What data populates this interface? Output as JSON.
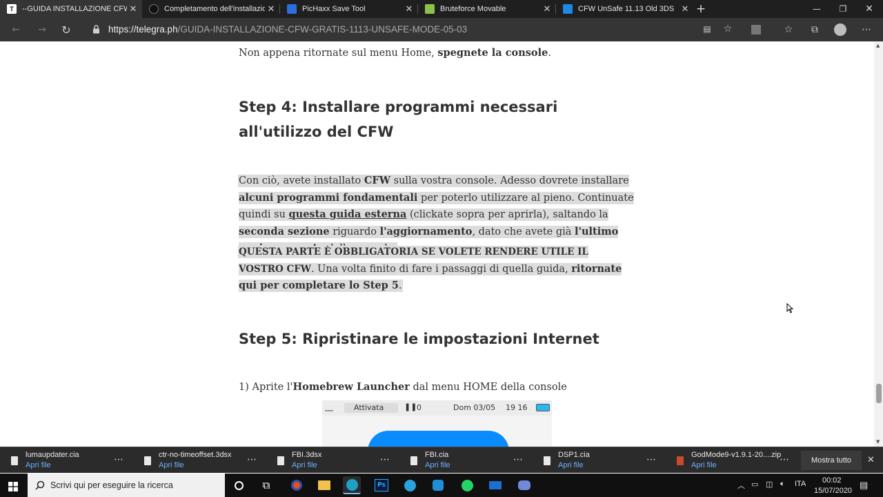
{
  "tabs": [
    {
      "title": "--GUIDA INSTALLAZIONE CFW GRATIS",
      "favicon": "T",
      "active": true
    },
    {
      "title": "Completamento dell'installazione",
      "favicon": "",
      "active": false
    },
    {
      "title": "PicHaxx Save Tool",
      "favicon": "",
      "active": false
    },
    {
      "title": "Bruteforce Movable",
      "favicon": "",
      "active": false
    },
    {
      "title": "CFW UnSafe 11.13 Old 3DS",
      "favicon": "",
      "active": false
    }
  ],
  "address": {
    "scheme": "https://",
    "host": "telegra.ph",
    "path": "/GUIDA-INSTALLAZIONE-CFW-GRATIS-1113-UNSAFE-MODE-05-03"
  },
  "article": {
    "p_top": {
      "t1": "Non appena ritornate sul menu Home, ",
      "b1": "spegnete la console",
      "t2": "."
    },
    "h_step4": "Step 4: Installare programmi necessari all'utilizzo del CFW",
    "p1": {
      "a": "Con ciò, avete installato ",
      "b": "CFW",
      "c": " sulla vostra console. Adesso dovrete installare ",
      "d": "alcuni programmi fondamentali",
      "e": " per poterlo utilizzare al pieno. Continuate quindi su ",
      "f": "questa guida esterna",
      "g": " (clickate sopra per aprirla), saltando la ",
      "h": "seconda sezione",
      "i": " riguardo ",
      "j": "l'aggiornamento",
      "k": ", dato che avete già ",
      "l": "l'ultimo aggiornamento",
      "m": " della console."
    },
    "p2": {
      "a": "QUESTA PARTE È OBBLIGATORIA SE VOLETE RENDERE UTILE IL VOSTRO CFW",
      "b": ". Una volta finito di fare i passaggi di quella guida, ",
      "c": "ritornate qui per completare lo Step 5",
      "d": "."
    },
    "h_step5": "Step 5: Ripristinare le impostazioni Internet",
    "p3": {
      "a": "1) Aprite l'",
      "b": "Homebrew Launcher",
      "c": " dal menu HOME della console"
    },
    "shot": {
      "status": "Attivata",
      "steps": "0",
      "date": "Dom 03/05",
      "time": "19 16"
    }
  },
  "downloads": [
    {
      "name": "lumaupdater.cia",
      "action": "Apri file"
    },
    {
      "name": "ctr-no-timeoffset.3dsx",
      "action": "Apri file"
    },
    {
      "name": "FBI.3dsx",
      "action": "Apri file"
    },
    {
      "name": "FBI.cia",
      "action": "Apri file"
    },
    {
      "name": "DSP1.cia",
      "action": "Apri file"
    },
    {
      "name": "GodMode9-v1.9.1-20....zip",
      "action": "Apri file"
    }
  ],
  "downloads_show_all": "Mostra tutto",
  "taskbar": {
    "search_placeholder": "Scrivi qui per eseguire la ricerca",
    "lang": "ITA",
    "time": "00:02",
    "date": "15/07/2020"
  },
  "colors": {
    "tabbar": "#1f1f1f",
    "toolbar": "#353535",
    "highlight": "#dcdcdc",
    "link": "#6cb2ff"
  }
}
